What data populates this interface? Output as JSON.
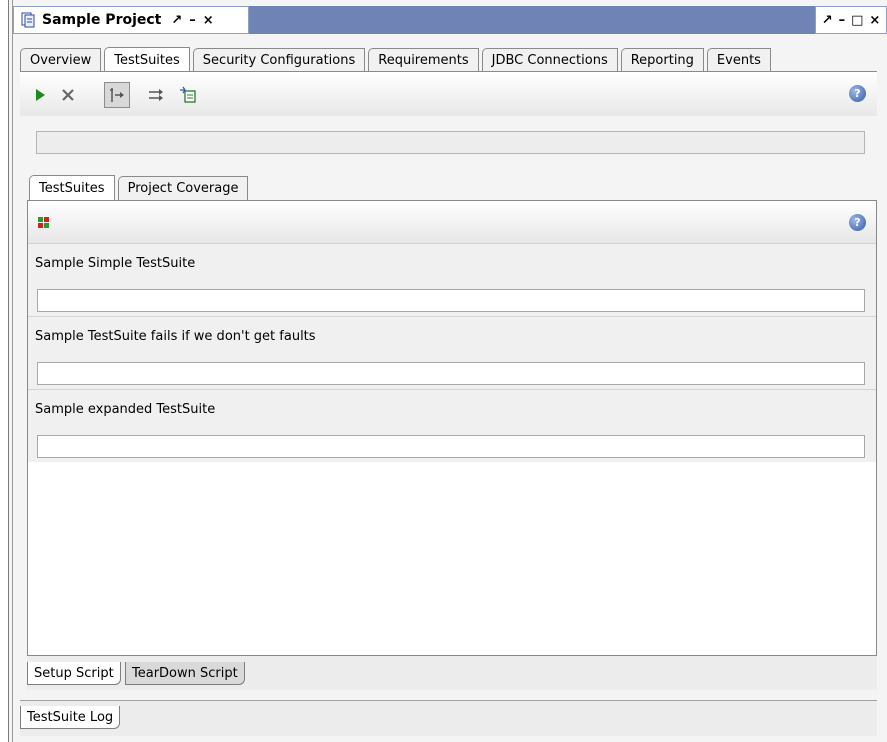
{
  "window": {
    "title": "Sample Project",
    "controls": [
      "↗",
      "–",
      "×"
    ],
    "right_controls": [
      "↗",
      "–",
      "□",
      "×"
    ]
  },
  "main_tabs": [
    {
      "label": "Overview",
      "active": false
    },
    {
      "label": "TestSuites",
      "active": true
    },
    {
      "label": "Security Configurations",
      "active": false
    },
    {
      "label": "Requirements",
      "active": false
    },
    {
      "label": "JDBC Connections",
      "active": false
    },
    {
      "label": "Reporting",
      "active": false
    },
    {
      "label": "Events",
      "active": false
    }
  ],
  "toolbar": {
    "icons": [
      "run-icon",
      "cancel-icon",
      "sequential-icon",
      "parallel-icon",
      "new-testsuite-icon"
    ],
    "help": "?"
  },
  "progress": {
    "value": 0
  },
  "sub_tabs": [
    {
      "label": "TestSuites",
      "active": true
    },
    {
      "label": "Project Coverage",
      "active": false
    }
  ],
  "sub_toolbar": {
    "icon": "grid-icon",
    "help": "?"
  },
  "suites": [
    {
      "label": "Sample Simple TestSuite",
      "progress": 0
    },
    {
      "label": "Sample TestSuite fails if we don't get faults",
      "progress": 0
    },
    {
      "label": "Sample expanded TestSuite",
      "progress": 0
    }
  ],
  "bottom_tabs": {
    "setup": "Setup Script",
    "teardown": "TearDown Script",
    "log": "TestSuite Log"
  },
  "colors": {
    "title_bar": "#6f84b4",
    "run": "#1e8a1e",
    "help": "#3357a8"
  }
}
